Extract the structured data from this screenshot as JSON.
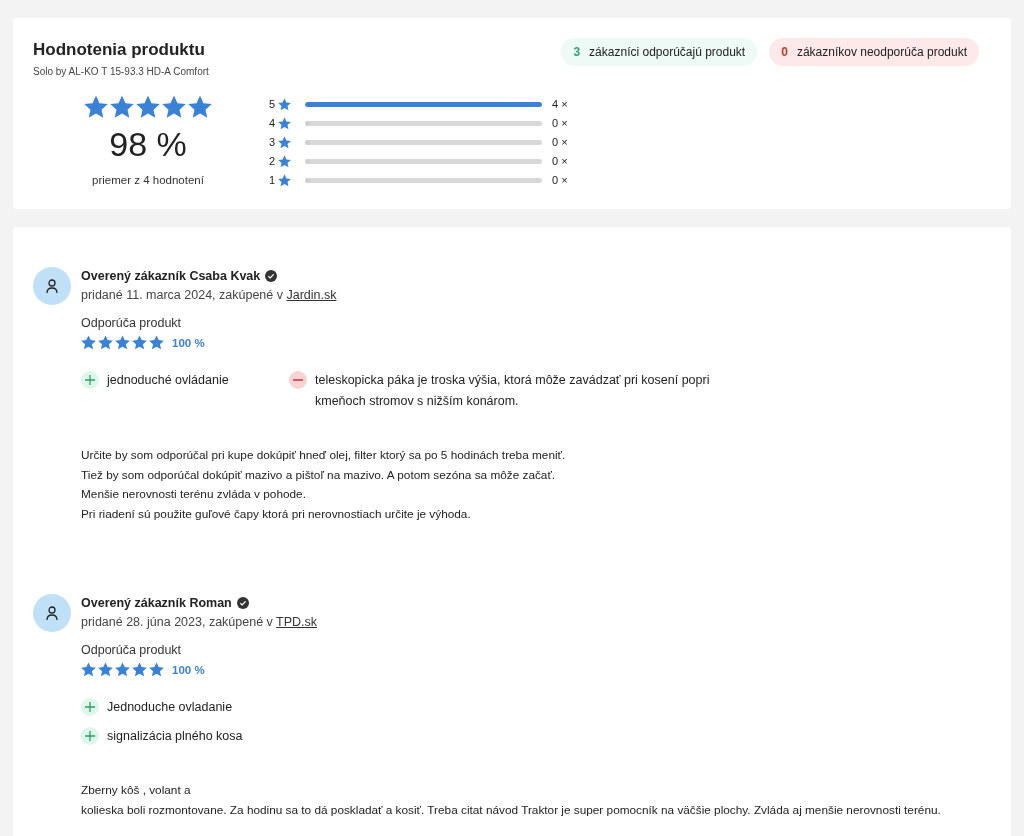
{
  "summary": {
    "title": "Hodnotenia produktu",
    "product": "Solo by AL-KO T 15-93.3 HD-A Comfort",
    "badges": [
      {
        "kind": "positive",
        "count": "3",
        "label": "zákazníci odporúčajú produkt"
      },
      {
        "kind": "negative",
        "count": "0",
        "label": "zákazníkov neodporúča produkt"
      }
    ],
    "stars": 5,
    "score": "98 %",
    "caption": "priemer z 4 hodnotení",
    "distribution": [
      {
        "rating": "5",
        "level": 1,
        "count": "4 ×"
      },
      {
        "rating": "4",
        "level": 0,
        "count": "0 ×"
      },
      {
        "rating": "3",
        "level": 0,
        "count": "0 ×"
      },
      {
        "rating": "2",
        "level": 0,
        "count": "0 ×"
      },
      {
        "rating": "1",
        "level": 0,
        "count": "0 ×"
      }
    ]
  },
  "reviews": [
    {
      "author": "Overený zákazník Csaba Kvak",
      "verified": true,
      "meta": "pridané 11. marca 2024, zakúpené v",
      "shop": "Jardin.sk",
      "recommendation": "Odporúča produkt",
      "stars": 5,
      "percent": "100 %",
      "pros": [
        "jednoduché ovládanie"
      ],
      "cons": [
        "teleskopicka páka je troska výšia, ktorá môže zavádzať pri kosení popri kmeňoch stromov s nižším konárom."
      ],
      "text": [
        "Určite by som odporúčal pri kupe dokúpiť hneď olej, filter ktorý sa po 5 hodinách treba meniť.",
        "Tiež by som odporúčal dokúpiť mazivo a pištoľ na mazivo. A potom sezóna sa môže začať.",
        "Menšie nerovnosti terénu zvláda v pohode.",
        "Pri riadení sú použite guľové čapy ktorá pri nerovnostiach určite je výhoda."
      ]
    },
    {
      "author": "Overený zákazník Roman",
      "verified": true,
      "meta": "pridané 28. júna 2023, zakúpené v",
      "shop": "TPD.sk",
      "recommendation": "Odporúča produkt",
      "stars": 5,
      "percent": "100 %",
      "pros": [
        "Jednoduche ovladanie",
        "signalizácia plného kosa"
      ],
      "text": [
        "Zberny kôš , volant a",
        "kolieska boli rozmontovane. Za hodinu sa to dá poskladať a kosiť. Treba citat návod Traktor je super pomocník na väčšie plochy. Zvláda aj menšie nerovnosti terénu."
      ]
    }
  ]
}
